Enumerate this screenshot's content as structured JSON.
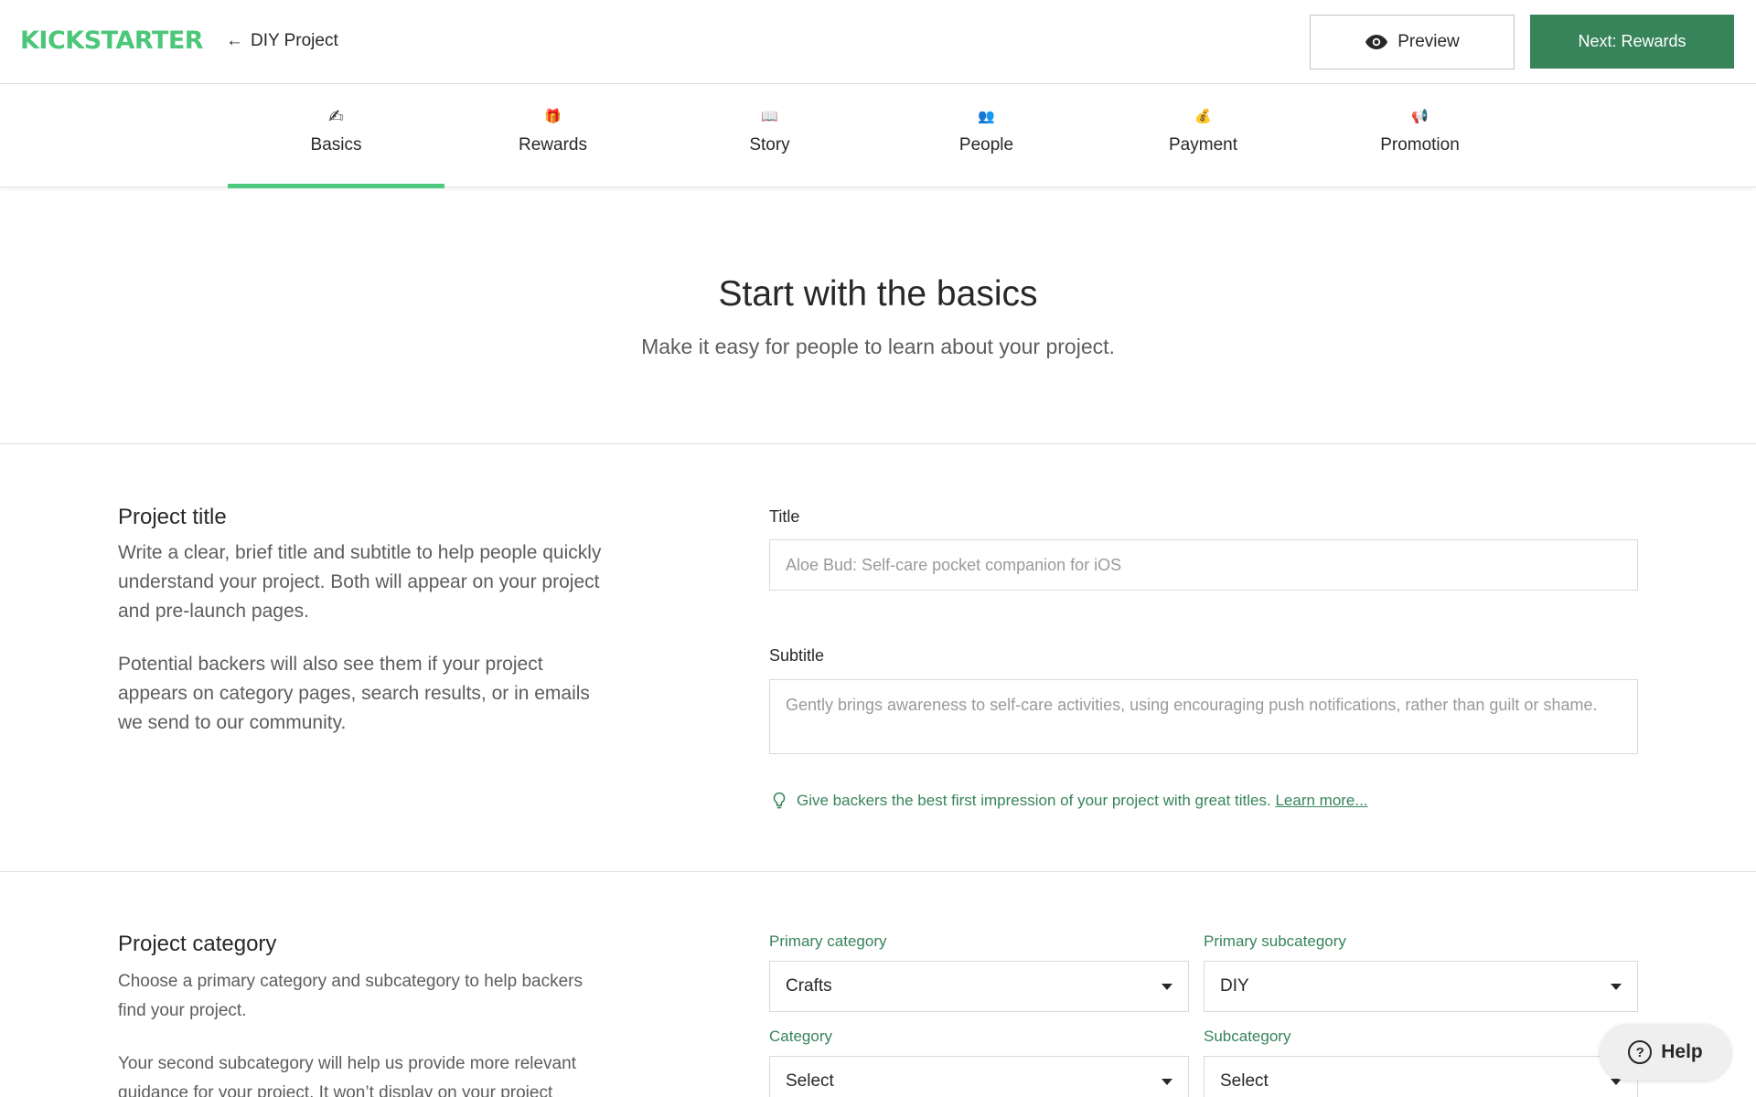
{
  "header": {
    "logo": "KICKSTARTER",
    "back_label": "DIY Project",
    "preview_label": "Preview",
    "next_label": "Next: Rewards"
  },
  "tabs": [
    {
      "label": "Basics",
      "icon": "✍",
      "active": true
    },
    {
      "label": "Rewards",
      "icon": "🎁"
    },
    {
      "label": "Story",
      "icon": "📖"
    },
    {
      "label": "People",
      "icon": "👥"
    },
    {
      "label": "Payment",
      "icon": "💰"
    },
    {
      "label": "Promotion",
      "icon": "📢"
    }
  ],
  "intro": {
    "title": "Start with the basics",
    "subtitle": "Make it easy for people to learn about your project."
  },
  "project_title": {
    "heading": "Project title",
    "desc1": "Write a clear, brief title and subtitle to help people quickly understand your project. Both will appear on your project and pre-launch pages.",
    "desc2": "Potential backers will also see them if your project appears on category pages, search results, or in emails we send to our community.",
    "title_label": "Title",
    "title_placeholder": "Aloe Bud: Self-care pocket companion for iOS",
    "subtitle_label": "Subtitle",
    "subtitle_placeholder": "Gently brings awareness to self-care activities, using encouraging push notifications, rather than guilt or shame.",
    "hint_text": "Give backers the best first impression of your project with great titles.",
    "hint_link": "Learn more..."
  },
  "project_category": {
    "heading": "Project category",
    "desc1": "Choose a primary category and subcategory to help backers find your project.",
    "desc2": "Your second subcategory will help us provide more relevant guidance for your project. It won’t display on your project",
    "primary_category_label": "Primary category",
    "primary_category_value": "Crafts",
    "primary_subcategory_label": "Primary subcategory",
    "primary_subcategory_value": "DIY",
    "category_label": "Category",
    "category_value": "Select",
    "subcategory_label": "Subcategory",
    "subcategory_value": "Select"
  },
  "help_label": "Help",
  "colors": {
    "brand_green": "#4cc77a",
    "button_green": "#37845b",
    "tab_underline": "#4ecb7f"
  }
}
